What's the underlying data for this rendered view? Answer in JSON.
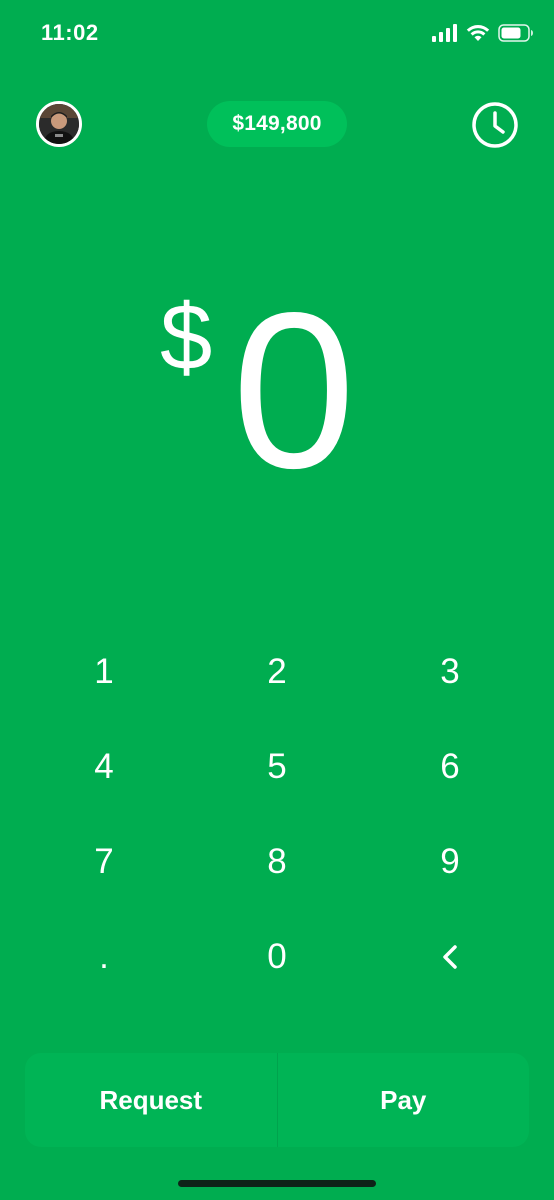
{
  "status_bar": {
    "time": "11:02"
  },
  "header": {
    "avatar_icon": "user-avatar",
    "balance": "$149,800",
    "history_icon": "clock-icon"
  },
  "amount": {
    "currency": "$",
    "value": "0"
  },
  "keypad": {
    "keys": [
      "1",
      "2",
      "3",
      "4",
      "5",
      "6",
      "7",
      "8",
      "9",
      ".",
      "0",
      "‹"
    ]
  },
  "actions": {
    "request_label": "Request",
    "pay_label": "Pay"
  },
  "colors": {
    "background": "#00ad50",
    "pill": "#00c05a",
    "action_bar": "#00b455",
    "text": "#ffffff"
  }
}
